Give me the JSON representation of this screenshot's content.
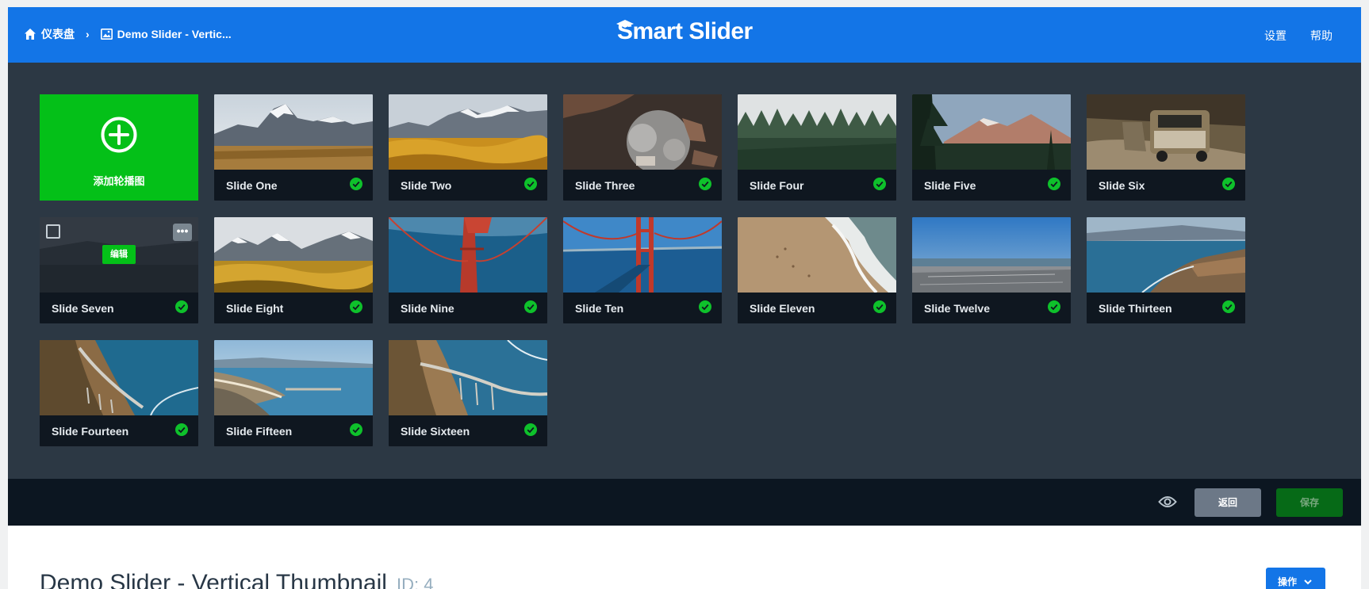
{
  "breadcrumb": {
    "dashboard": "仪表盘",
    "current": "Demo Slider - Vertic..."
  },
  "logo": "Smart Slider",
  "top_links": {
    "settings": "设置",
    "help": "帮助"
  },
  "add_slide_label": "添加轮播图",
  "edit_label": "编辑",
  "dots_label": "•••",
  "slides": [
    {
      "title": "Slide One"
    },
    {
      "title": "Slide Two"
    },
    {
      "title": "Slide Three"
    },
    {
      "title": "Slide Four"
    },
    {
      "title": "Slide Five"
    },
    {
      "title": "Slide Six"
    },
    {
      "title": "Slide Seven"
    },
    {
      "title": "Slide Eight"
    },
    {
      "title": "Slide Nine"
    },
    {
      "title": "Slide Ten"
    },
    {
      "title": "Slide Eleven"
    },
    {
      "title": "Slide Twelve"
    },
    {
      "title": "Slide Thirteen"
    },
    {
      "title": "Slide Fourteen"
    },
    {
      "title": "Slide Fifteen"
    },
    {
      "title": "Slide Sixteen"
    }
  ],
  "toolbar": {
    "back_label": "返回",
    "save_label": "保存"
  },
  "page": {
    "title": "Demo Slider - Vertical Thumbnail",
    "id_label": "ID: 4",
    "actions_label": "操作"
  },
  "colors": {
    "topbar": "#1375e7",
    "add": "#04c018",
    "panel": "#2c3844",
    "check": "#0ec12b"
  }
}
